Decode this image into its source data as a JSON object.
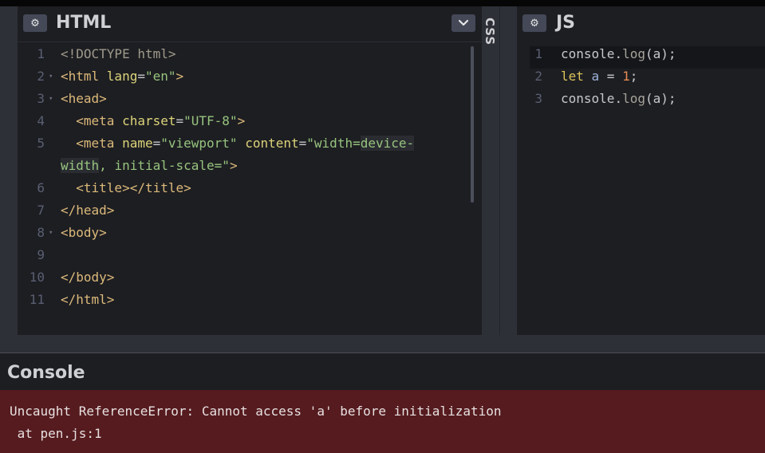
{
  "html_panel": {
    "title": "HTML",
    "settings_icon": "gear-icon",
    "dropdown_icon": "chevron-down-icon",
    "lines": [
      {
        "n": "1",
        "fold": false,
        "parts": [
          [
            "doctype",
            "<!DOCTYPE html>"
          ]
        ]
      },
      {
        "n": "2",
        "fold": true,
        "parts": [
          [
            "tag",
            "<html "
          ],
          [
            "attr",
            "lang"
          ],
          [
            "plain",
            "="
          ],
          [
            "str",
            "\"en\""
          ],
          [
            "tag",
            ">"
          ]
        ]
      },
      {
        "n": "3",
        "fold": true,
        "parts": [
          [
            "tag",
            "<head>"
          ]
        ]
      },
      {
        "n": "4",
        "fold": false,
        "parts": [
          [
            "plain",
            "  "
          ],
          [
            "tag",
            "<meta "
          ],
          [
            "attr",
            "charset"
          ],
          [
            "plain",
            "="
          ],
          [
            "str",
            "\"UTF-8\""
          ],
          [
            "tag",
            ">"
          ]
        ]
      },
      {
        "n": "5",
        "fold": false,
        "parts": [
          [
            "plain",
            "  "
          ],
          [
            "tag",
            "<meta "
          ],
          [
            "attr",
            "name"
          ],
          [
            "plain",
            "="
          ],
          [
            "str",
            "\"viewport\" "
          ],
          [
            "attr",
            "content"
          ],
          [
            "plain",
            "="
          ],
          [
            "str",
            "\"width="
          ],
          [
            "strhl",
            "device-"
          ]
        ]
      },
      {
        "n": "",
        "fold": false,
        "parts": [
          [
            "strhl",
            "width"
          ],
          [
            "str",
            ", initial-scale="
          ],
          [
            "str",
            "\""
          ],
          [
            "tag",
            ">"
          ]
        ]
      },
      {
        "n": "6",
        "fold": false,
        "parts": [
          [
            "plain",
            "  "
          ],
          [
            "tag",
            "<title></title>"
          ]
        ]
      },
      {
        "n": "7",
        "fold": false,
        "parts": [
          [
            "tag",
            "</head>"
          ]
        ]
      },
      {
        "n": "8",
        "fold": true,
        "parts": [
          [
            "tag",
            "<body>"
          ]
        ]
      },
      {
        "n": "9",
        "fold": false,
        "parts": []
      },
      {
        "n": "10",
        "fold": false,
        "parts": [
          [
            "tag",
            "</body>"
          ]
        ]
      },
      {
        "n": "11",
        "fold": false,
        "parts": [
          [
            "tag",
            "</html>"
          ]
        ]
      }
    ]
  },
  "css_panel": {
    "title": "CSS"
  },
  "js_panel": {
    "title": "JS",
    "settings_icon": "gear-icon",
    "lines": [
      {
        "n": "1",
        "parts": [
          [
            "plain",
            "console"
          ],
          [
            "plain",
            "."
          ],
          [
            "fn",
            "log"
          ],
          [
            "plain",
            "(a);"
          ]
        ]
      },
      {
        "n": "2",
        "parts": [
          [
            "kw",
            "let "
          ],
          [
            "var",
            "a"
          ],
          [
            "plain",
            " = "
          ],
          [
            "num",
            "1"
          ],
          [
            "plain",
            ";"
          ]
        ]
      },
      {
        "n": "3",
        "parts": [
          [
            "plain",
            "console"
          ],
          [
            "plain",
            "."
          ],
          [
            "fn",
            "log"
          ],
          [
            "plain",
            "(a);"
          ]
        ]
      }
    ]
  },
  "console": {
    "title": "Console",
    "error_line1": "Uncaught ReferenceError: Cannot access 'a' before initialization",
    "error_line2": " at pen.js:1"
  },
  "colors": {
    "background": "#1d1e22",
    "error_background": "#551b1f",
    "button": "#444857"
  }
}
